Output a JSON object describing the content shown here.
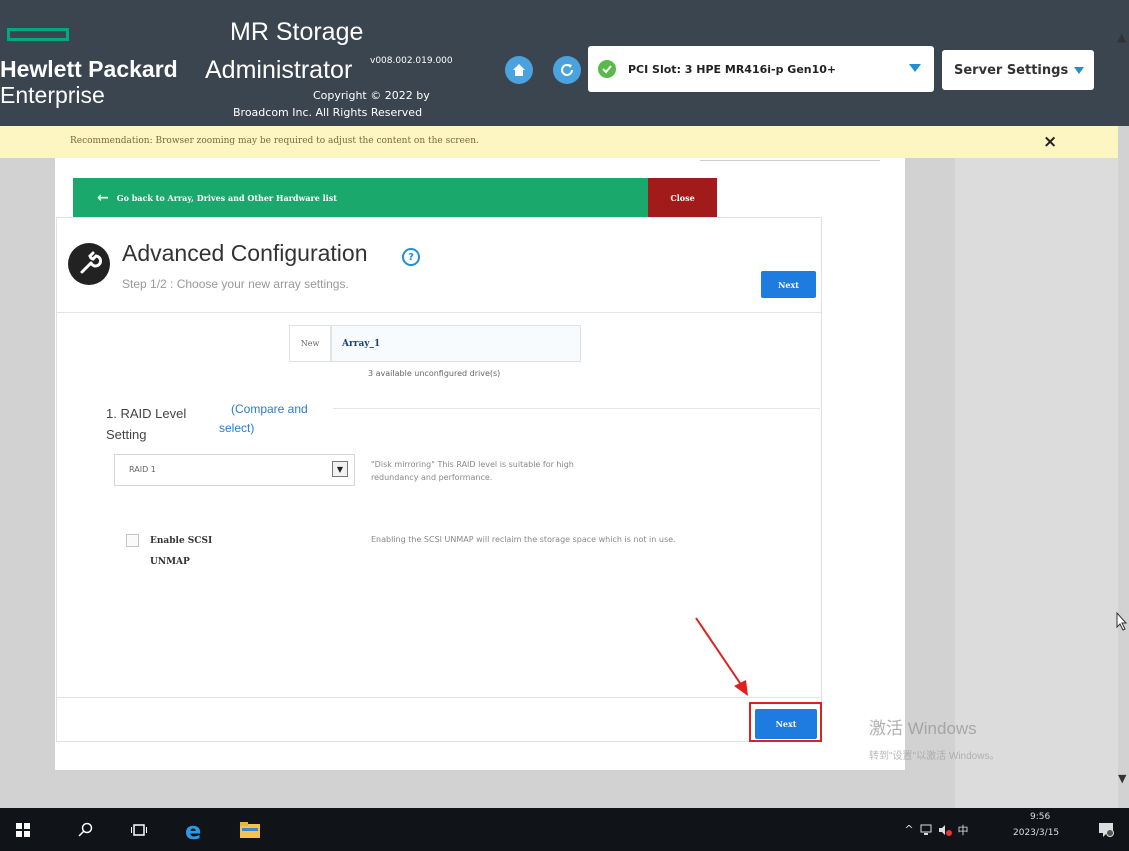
{
  "header": {
    "brand_line1": "Hewlett Packard",
    "brand_line2": "Enterprise",
    "app_title_line1": "MR Storage",
    "app_title_line2": "Administrator",
    "version": "v008.002.019.000",
    "copyright_line1": "Copyright © 2022 by",
    "copyright_line2": "Broadcom Inc. All Rights Reserved",
    "controller_select": "PCI Slot: 3 HPE MR416i-p Gen10+",
    "server_settings": "Server Settings"
  },
  "recommendation": {
    "text": "Recommendation: Browser zooming may be required to adjust the content on the screen.",
    "close": "×"
  },
  "nav": {
    "back_label": "Go back to Array, Drives and Other Hardware list",
    "close_label": "Close"
  },
  "wizard": {
    "title": "Advanced Configuration",
    "step": "Step 1/2 : Choose your new array settings.",
    "next_label": "Next",
    "new_label": "New",
    "array_name": "Array_1",
    "drives_available": "3 available unconfigured drive(s)",
    "raid_section_line1": "1. RAID Level",
    "raid_section_line2": "Setting",
    "compare_line1": "(Compare and",
    "compare_line2": "select)",
    "raid_selected": "RAID 1",
    "raid_description_line1": "\"Disk mirroring\" This RAID level is suitable for high",
    "raid_description_line2": "redundancy and performance.",
    "unmap_label_line1": "Enable SCSI",
    "unmap_label_line2": "UNMAP",
    "unmap_description": "Enabling the SCSI UNMAP will reclaim the storage space which is not in use."
  },
  "watermark": {
    "line1": "激活 Windows",
    "line2": "转到\"设置\"以激活 Windows。"
  },
  "taskbar": {
    "ime": "中",
    "time": "9:56",
    "date": "2023/3/15"
  },
  "colors": {
    "header_bg": "#3a4550",
    "hpe_green": "#01a982",
    "back_bar": "#1aa86c",
    "close_red": "#a21b1b",
    "next_blue": "#1e7be0",
    "highlight_red": "#e02020",
    "recommendation_bg": "#fdf6c3"
  }
}
